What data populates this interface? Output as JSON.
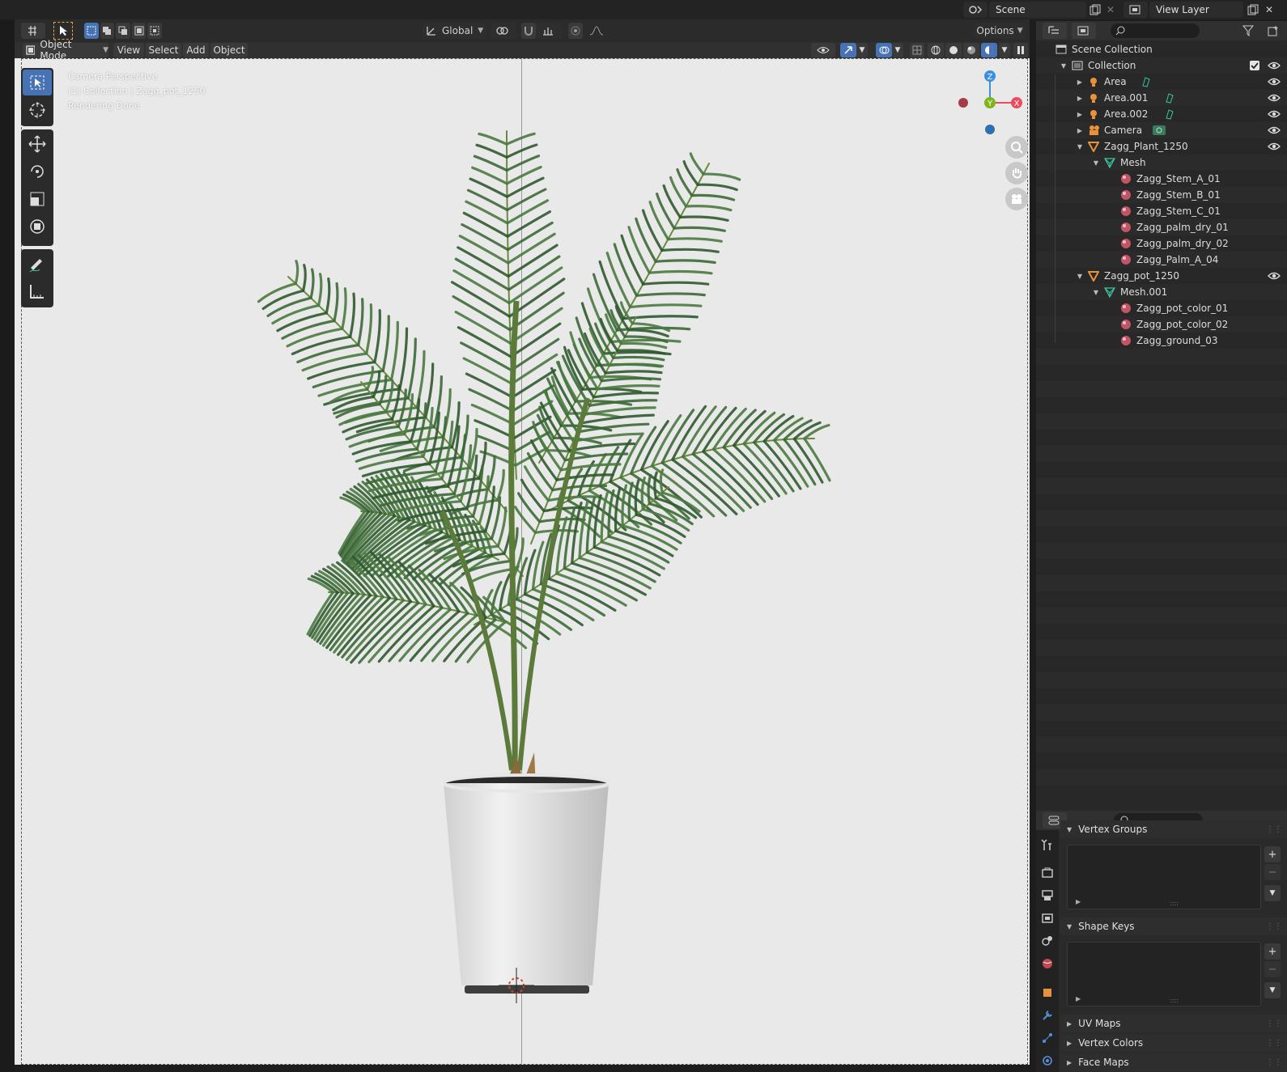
{
  "topbar": {
    "scene_label": "Scene",
    "view_layer_label": "View Layer"
  },
  "header": {
    "orientation": "Global",
    "options_label": "Options",
    "mode_label": "Object Mode",
    "menu": [
      "View",
      "Select",
      "Add",
      "Object"
    ]
  },
  "viewport": {
    "overlay_lines": [
      "Camera Perspective",
      "(1) Collection | Zagg_pot_1250",
      "Rendering Done"
    ],
    "gizmo_axes": {
      "z": "Z",
      "y": "Y",
      "x": "X"
    }
  },
  "outliner": {
    "rows": [
      {
        "label": "Scene Collection",
        "icon": "scene-collection-icon",
        "depth": 0,
        "expand": "",
        "eye": false,
        "check": false
      },
      {
        "label": "Collection",
        "icon": "collection-icon",
        "depth": 1,
        "expand": "down",
        "eye": true,
        "check": true
      },
      {
        "label": "Area",
        "icon": "light-icon",
        "depth": 2,
        "expand": "right",
        "eye": true,
        "check": false,
        "extra": "light-data-icon"
      },
      {
        "label": "Area.001",
        "icon": "light-icon",
        "depth": 2,
        "expand": "right",
        "eye": true,
        "check": false,
        "extra": "light-data-icon"
      },
      {
        "label": "Area.002",
        "icon": "light-icon",
        "depth": 2,
        "expand": "right",
        "eye": true,
        "check": false,
        "extra": "light-data-icon"
      },
      {
        "label": "Camera",
        "icon": "camera-icon",
        "depth": 2,
        "expand": "right",
        "eye": true,
        "check": false,
        "extra": "camera-data-icon"
      },
      {
        "label": "Zagg_Plant_1250",
        "icon": "mesh-object-icon",
        "depth": 2,
        "expand": "down",
        "eye": true,
        "check": false
      },
      {
        "label": "Mesh",
        "icon": "mesh-data-icon",
        "depth": 3,
        "expand": "down",
        "eye": false,
        "check": false
      },
      {
        "label": "Zagg_Stem_A_01",
        "icon": "material-icon",
        "depth": 4,
        "expand": "",
        "eye": false,
        "check": false
      },
      {
        "label": "Zagg_Stem_B_01",
        "icon": "material-icon",
        "depth": 4,
        "expand": "",
        "eye": false,
        "check": false
      },
      {
        "label": "Zagg_Stem_C_01",
        "icon": "material-icon",
        "depth": 4,
        "expand": "",
        "eye": false,
        "check": false
      },
      {
        "label": "Zagg_palm_dry_01",
        "icon": "material-icon",
        "depth": 4,
        "expand": "",
        "eye": false,
        "check": false
      },
      {
        "label": "Zagg_palm_dry_02",
        "icon": "material-icon",
        "depth": 4,
        "expand": "",
        "eye": false,
        "check": false
      },
      {
        "label": "Zagg_Palm_A_04",
        "icon": "material-icon",
        "depth": 4,
        "expand": "",
        "eye": false,
        "check": false
      },
      {
        "label": "Zagg_pot_1250",
        "icon": "mesh-object-icon",
        "depth": 2,
        "expand": "down",
        "eye": true,
        "check": false
      },
      {
        "label": "Mesh.001",
        "icon": "mesh-data-icon",
        "depth": 3,
        "expand": "down",
        "eye": false,
        "check": false
      },
      {
        "label": "Zagg_pot_color_01",
        "icon": "material-icon",
        "depth": 4,
        "expand": "",
        "eye": false,
        "check": false
      },
      {
        "label": "Zagg_pot_color_02",
        "icon": "material-icon",
        "depth": 4,
        "expand": "",
        "eye": false,
        "check": false
      },
      {
        "label": "Zagg_ground_03",
        "icon": "material-icon",
        "depth": 4,
        "expand": "",
        "eye": false,
        "check": false
      }
    ]
  },
  "properties": {
    "panels": [
      {
        "label": "Vertex Groups",
        "expanded": true
      },
      {
        "label": "Shape Keys",
        "expanded": true
      },
      {
        "label": "UV Maps",
        "expanded": false
      },
      {
        "label": "Vertex Colors",
        "expanded": false
      },
      {
        "label": "Face Maps",
        "expanded": false
      }
    ],
    "tabs": [
      "tool-icon",
      "render-icon",
      "output-icon",
      "view-layer-icon",
      "scene-icon",
      "world-icon",
      "object-icon",
      "modifier-icon",
      "particles-icon",
      "physics-icon"
    ]
  },
  "colors": {
    "accent_blue": "#4772b3",
    "axis_x": "#e94c5c",
    "axis_y": "#7fb51b",
    "axis_z": "#3b8fe0",
    "material": "#c25565",
    "mesh_green": "#3bc5a0",
    "object_orange": "#e8923a"
  }
}
